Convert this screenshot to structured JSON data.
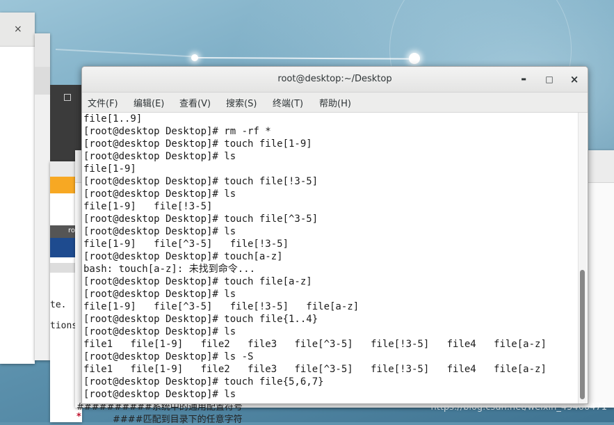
{
  "terminal": {
    "title": "root@desktop:~/Desktop",
    "minimize_glyph": "▬",
    "maximize_glyph": "□",
    "close_glyph": "×",
    "menu": [
      "文件(F)",
      "编辑(E)",
      "查看(V)",
      "搜索(S)",
      "终端(T)",
      "帮助(H)"
    ],
    "lines": [
      "file[1..9]",
      "[root@desktop Desktop]# rm -rf *",
      "[root@desktop Desktop]# touch file[1-9]",
      "[root@desktop Desktop]# ls",
      "file[1-9]",
      "[root@desktop Desktop]# touch file[!3-5]",
      "[root@desktop Desktop]# ls",
      "file[1-9]   file[!3-5]",
      "[root@desktop Desktop]# touch file[^3-5]",
      "[root@desktop Desktop]# ls",
      "file[1-9]   file[^3-5]   file[!3-5]",
      "[root@desktop Desktop]# touch[a-z]",
      "bash: touch[a-z]: 未找到命令...",
      "[root@desktop Desktop]# touch file[a-z]",
      "[root@desktop Desktop]# ls",
      "file[1-9]   file[^3-5]   file[!3-5]   file[a-z]",
      "[root@desktop Desktop]# touch file{1..4}",
      "[root@desktop Desktop]# ls",
      "file1   file[1-9]   file2   file3   file[^3-5]   file[!3-5]   file4   file[a-z]",
      "[root@desktop Desktop]# ls -S",
      "file1   file[1-9]   file2   file3   file[^3-5]   file[!3-5]   file4   file[a-z]",
      "[root@desktop Desktop]# touch file{5,6,7}",
      "[root@desktop Desktop]# ls"
    ]
  },
  "background_windows": {
    "top_left_close": "×",
    "left_snippets": {
      "te": "te.",
      "tions": "tions",
      "ro": "ro"
    },
    "editor_lines": {
      "hash_line": "##########系统中的通用配置符号",
      "star": "*",
      "star_comment": "####匹配到目录下的任意字符"
    }
  },
  "watermark": "https://blog.csdn.net/weixin_45466471"
}
